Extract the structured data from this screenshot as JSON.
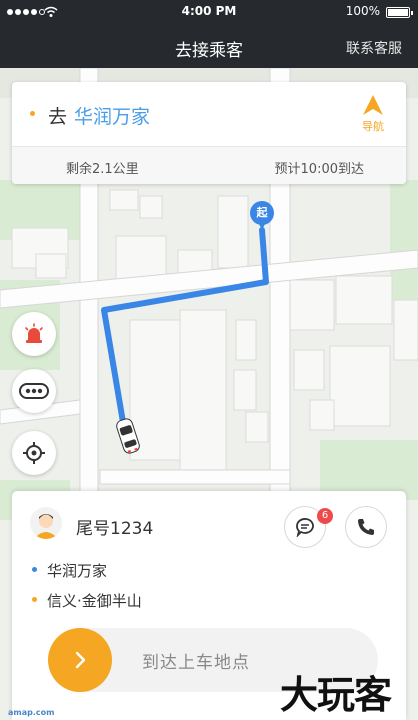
{
  "status_bar": {
    "time": "4:00 PM",
    "battery": "100%"
  },
  "nav": {
    "title": "去接乘客",
    "contact": "联系客服"
  },
  "route": {
    "go_label": "去",
    "destination": "华润万家",
    "nav_label": "导航",
    "remaining": "剩余2.1公里",
    "eta": "预计10:00到达"
  },
  "map": {
    "start_marker": "起"
  },
  "passenger": {
    "tail_number": "尾号1234",
    "message_badge": "6",
    "pickup": "华润万家",
    "dropoff": "信义·金御半山",
    "pickup_color": "#3a86e6",
    "dropoff_color": "#f5a623",
    "slider_label": "到达上车地点"
  },
  "footer": {
    "amap": "amap.com",
    "watermark": "大玩客"
  },
  "colors": {
    "accent": "#f5a623",
    "route": "#3a86e6",
    "navbar": "#26292e"
  }
}
